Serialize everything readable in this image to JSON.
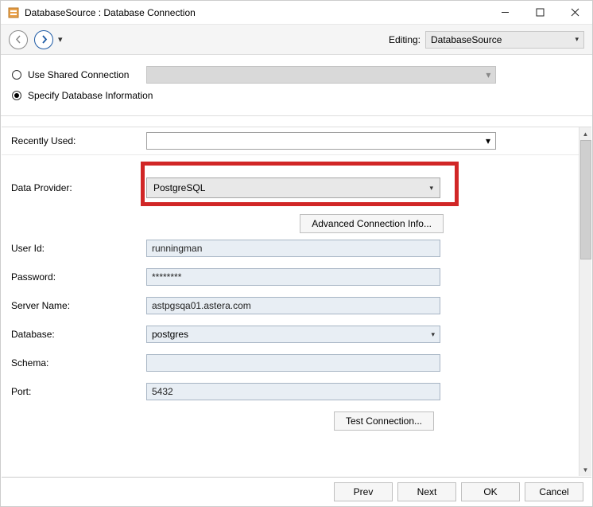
{
  "window": {
    "title": "DatabaseSource : Database Connection"
  },
  "nav": {
    "editing_label": "Editing:",
    "editing_value": "DatabaseSource"
  },
  "mode": {
    "shared_label": "Use Shared Connection",
    "specify_label": "Specify Database Information",
    "selected": "specify"
  },
  "recently": {
    "label": "Recently Used:",
    "value": ""
  },
  "provider": {
    "label": "Data Provider:",
    "value": "PostgreSQL",
    "advanced_label": "Advanced Connection Info..."
  },
  "fields": {
    "user_id": {
      "label": "User Id:",
      "value": "runningman"
    },
    "password": {
      "label": "Password:",
      "value": "********"
    },
    "server_name": {
      "label": "Server Name:",
      "value": "astpgsqa01.astera.com"
    },
    "database": {
      "label": "Database:",
      "value": "postgres"
    },
    "schema": {
      "label": "Schema:",
      "value": ""
    },
    "port": {
      "label": "Port:",
      "value": "5432"
    }
  },
  "buttons": {
    "test": "Test Connection...",
    "prev": "Prev",
    "next": "Next",
    "ok": "OK",
    "cancel": "Cancel"
  }
}
